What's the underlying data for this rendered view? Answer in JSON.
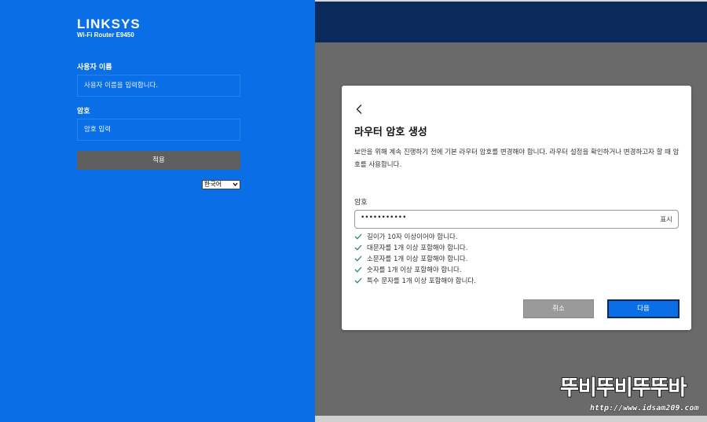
{
  "brand": {
    "logo": "LINKSYS",
    "model": "Wi-Fi Router E9450"
  },
  "login": {
    "username_label": "사용자 이름",
    "username_placeholder": "사용자 이름을 입력합니다.",
    "password_label": "암호",
    "password_placeholder": "암호 입력",
    "apply_label": "적용",
    "language": "한국어"
  },
  "modal": {
    "title": "라우터 암호 생성",
    "description": "보안을 위해 계속 진행하기 전에 기본 라우터 암호를 변경해야 합니다. 라우터 설정을 확인하거나 변경하고자 할 때 암호를 사용합니다.",
    "password_label": "암호",
    "password_value": "•••••••••••",
    "show_label": "표시",
    "rules": [
      "길이가 10자 이상이어야 합니다.",
      "대문자를 1개 이상 포함해야 합니다.",
      "소문자를 1개 이상 포함해야 합니다.",
      "숫자를 1개 이상 포함해야 합니다.",
      "특수 문자를 1개 이상 포함해야 합니다."
    ],
    "cancel_label": "취소",
    "next_label": "다음"
  },
  "watermark": {
    "text": "뚜비뚜비뚜뚜바",
    "url": "http://www.idsam209.com"
  },
  "colors": {
    "primary_blue": "#0a6fe6",
    "navy": "#0a2a5c",
    "check_green": "#2e8b57"
  }
}
